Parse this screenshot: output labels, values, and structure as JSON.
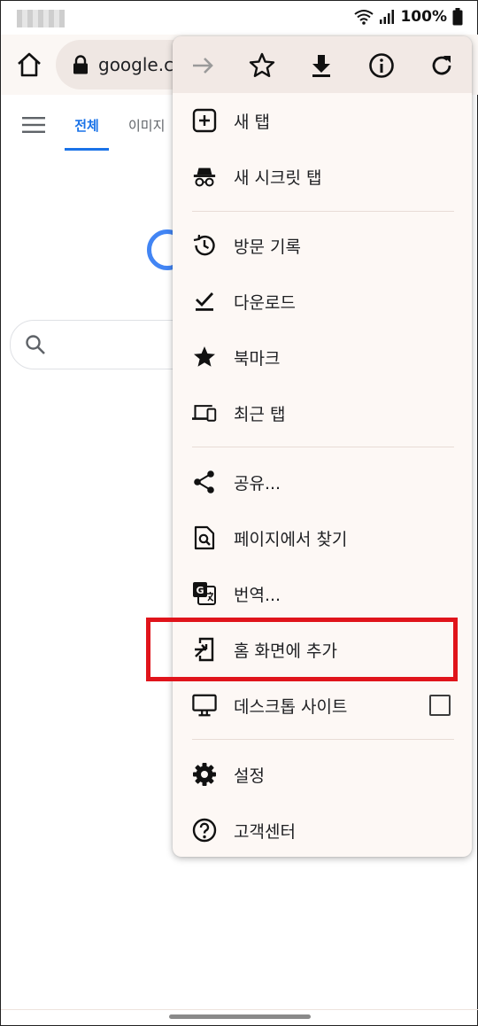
{
  "status": {
    "battery": "100%"
  },
  "toolbar": {
    "url": "google.co"
  },
  "page": {
    "tabs": [
      {
        "label": "전체"
      },
      {
        "label": "이미지"
      }
    ]
  },
  "menu": {
    "top_icons": [
      "forward-arrow-icon",
      "star-outline-icon",
      "download-icon",
      "info-icon",
      "refresh-icon"
    ],
    "items": [
      {
        "label": "새 탭",
        "icon": "plus-box-icon"
      },
      {
        "label": "새 시크릿 탭",
        "icon": "incognito-icon"
      },
      {
        "label": "방문 기록",
        "icon": "history-icon"
      },
      {
        "label": "다운로드",
        "icon": "download-check-icon"
      },
      {
        "label": "북마크",
        "icon": "star-filled-icon"
      },
      {
        "label": "최근 탭",
        "icon": "devices-icon"
      },
      {
        "label": "공유...",
        "icon": "share-icon"
      },
      {
        "label": "페이지에서 찾기",
        "icon": "find-in-page-icon"
      },
      {
        "label": "번역...",
        "icon": "translate-icon"
      },
      {
        "label": "홈 화면에 추가",
        "icon": "add-to-home-icon"
      },
      {
        "label": "데스크톱 사이트",
        "icon": "desktop-icon",
        "checked": false
      },
      {
        "label": "설정",
        "icon": "gear-icon"
      },
      {
        "label": "고객센터",
        "icon": "help-icon"
      }
    ]
  },
  "colors": {
    "accent": "#1a73e8",
    "highlight": "#e0141b",
    "menu_bg": "#fdf8f5",
    "menu_top_bg": "#f2e9e5"
  }
}
